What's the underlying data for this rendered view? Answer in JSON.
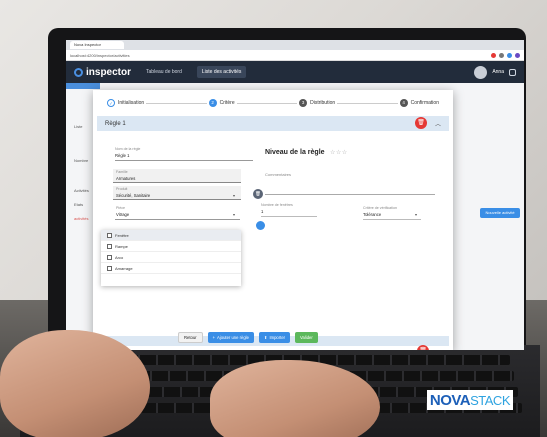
{
  "browser": {
    "tab_title": "Nova Inspector",
    "url": "localhost:4200/inspector/activities"
  },
  "app": {
    "logo_text": "inspector",
    "nav": [
      "Tableau de bord",
      "Liste des activités"
    ],
    "user_name": "Anna"
  },
  "background": {
    "side_labels": [
      "Liste",
      "Nombre",
      "Activités",
      "Etats",
      "activités"
    ],
    "new_activity_button": "Nouvelle activité"
  },
  "modal": {
    "steps": [
      {
        "num": "",
        "label": "Initialisation"
      },
      {
        "num": "2",
        "label": "Critère"
      },
      {
        "num": "3",
        "label": "Distribution"
      },
      {
        "num": "4",
        "label": "Confirmation"
      }
    ],
    "rule_title": "Règle 1",
    "fields": {
      "rule_name_label": "Nom de la règle",
      "rule_name_value": "Règle 1",
      "field1_label": "Famille",
      "field1_value": "Armatures",
      "field2_label": "Produit",
      "field2_value": "Sécurité, Sanitaire",
      "field3_label": "Pièce",
      "field3_value": "Vitrage"
    },
    "level_title": "Niveau de la règle",
    "stars": "☆☆☆",
    "comments_label": "Commentaires",
    "count_label": "Nombre de fenêtres",
    "count_value": "1",
    "verify_label": "Critère de vérification",
    "verify_value": "Tolérance",
    "menu_items": [
      "Fenêtre",
      "Rampe",
      "Arco",
      "Amarrage"
    ],
    "buttons": {
      "cancel": "Retour",
      "add_rule": "Ajouter une règle",
      "import": "Importer",
      "validate": "Valider"
    }
  },
  "brand": {
    "part1": "NOVA",
    "part2": "STACK"
  },
  "colors": {
    "accent": "#3a8ee6",
    "danger": "#e53935",
    "success": "#5cb85c",
    "header": "#222c3b"
  }
}
